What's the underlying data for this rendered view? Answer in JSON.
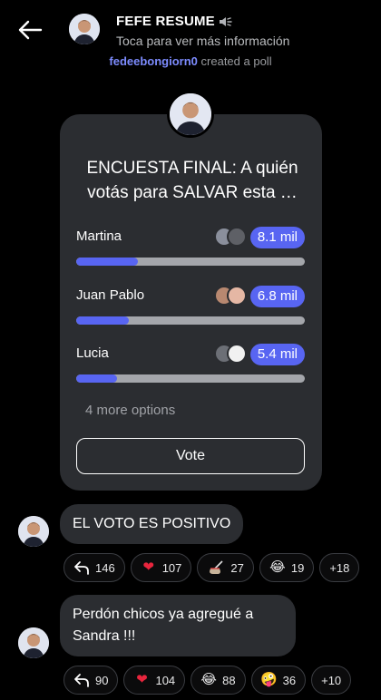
{
  "header": {
    "title": "FEFE RESUME",
    "subtitle": "Toca para ver más información"
  },
  "system": {
    "user": "fedeebongiorn0",
    "action": "created a poll"
  },
  "poll": {
    "question": "ENCUESTA FINAL: A quién votás para SALVAR esta …",
    "options": [
      {
        "label": "Martina",
        "count": "8.1 mil",
        "fraction": 0.27
      },
      {
        "label": "Juan Pablo",
        "count": "6.8 mil",
        "fraction": 0.23
      },
      {
        "label": "Lucia",
        "count": "5.4 mil",
        "fraction": 0.18
      }
    ],
    "more_options": "4 more options",
    "vote_label": "Vote"
  },
  "messages": [
    {
      "text": "EL VOTO ES POSITIVO",
      "reactions": [
        {
          "icon": "reply-arrow-icon",
          "count": "146"
        },
        {
          "icon": "red-heart-icon",
          "count": "107"
        },
        {
          "icon": "mate-icon",
          "count": "27"
        },
        {
          "icon": "laughing-face-icon",
          "count": "19"
        },
        {
          "icon": "more-reactions",
          "count": "+18"
        }
      ]
    },
    {
      "text_line1": "Perdón chicos ya agregué a",
      "text_line2": "Sandra !!!",
      "reactions": [
        {
          "icon": "reply-arrow-icon",
          "count": "90"
        },
        {
          "icon": "red-heart-icon",
          "count": "104"
        },
        {
          "icon": "laughing-face-icon",
          "count": "88"
        },
        {
          "icon": "zany-face-icon",
          "count": "36"
        },
        {
          "icon": "more-reactions",
          "count": "+10"
        }
      ]
    }
  ],
  "colors": {
    "accent": "#5865f2",
    "card": "#2b2d31",
    "username": "#7d8cff",
    "background": "#000000"
  }
}
